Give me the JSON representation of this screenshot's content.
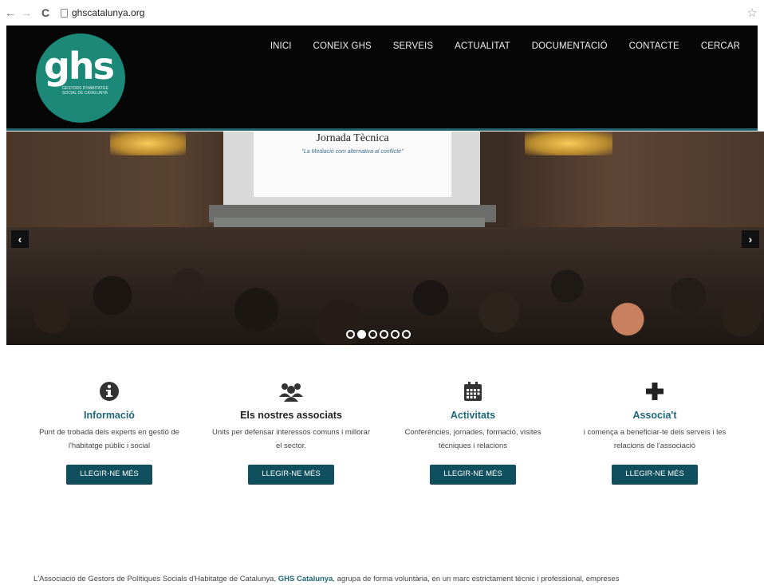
{
  "browser": {
    "back_icon": "arrow-left-icon",
    "forward_icon": "arrow-right-icon",
    "reload_icon": "reload-icon",
    "url": "ghscatalunya.org",
    "bookmark_icon": "star-icon"
  },
  "header": {
    "logo_text": "ghs",
    "logo_subtext": "GESTORS D'HABITATGE SOCIAL DE CATALUNYA",
    "nav": [
      "INICI",
      "CONEIX GHS",
      "SERVEIS",
      "ACTUALITAT",
      "DOCUMENTACIÓ",
      "CONTACTE",
      "CERCAR"
    ]
  },
  "slider": {
    "screen_title": "Jornada Tècnica",
    "screen_subtitle": "\"La Mediació com alternativa al conflicte\"",
    "prev_label": "‹",
    "next_label": "›",
    "slide_count": 6,
    "active_slide": 2
  },
  "features": [
    {
      "icon": "info-icon",
      "title": "Informació",
      "desc": "Punt de trobada dels experts en gestió de l'habitatge públic i social",
      "button": "LLEGIR-NE MÉS"
    },
    {
      "icon": "users-icon",
      "title": "Els nostres associats",
      "desc": "Units per defensar interessos comuns i millorar el sector.",
      "button": "LLEGIR-NE MÉS"
    },
    {
      "icon": "calendar-icon",
      "title": "Activitats",
      "desc": "Conferències, jornades, formació, visites tècniques i relacions",
      "button": "LLEGIR-NE MÉS"
    },
    {
      "icon": "plus-icon",
      "title": "Associa't",
      "desc": "i comença a beneficiar-te dels serveis i les relacions de l'associació",
      "button": "LLEGIR-NE MÉS"
    }
  ],
  "footer": {
    "text_before": "L'Associació de Gestors de Polítiques Socials d'Habitatge de Catalunya, ",
    "bold": "GHS Catalunya",
    "text_after": ", agrupa de forma voluntària, en un marc estrictament tècnic i professional, empreses"
  },
  "colors": {
    "header_bg": "#060606",
    "logo": "#1b8878",
    "accent": "#1d6877",
    "button": "#0f4f5e"
  }
}
